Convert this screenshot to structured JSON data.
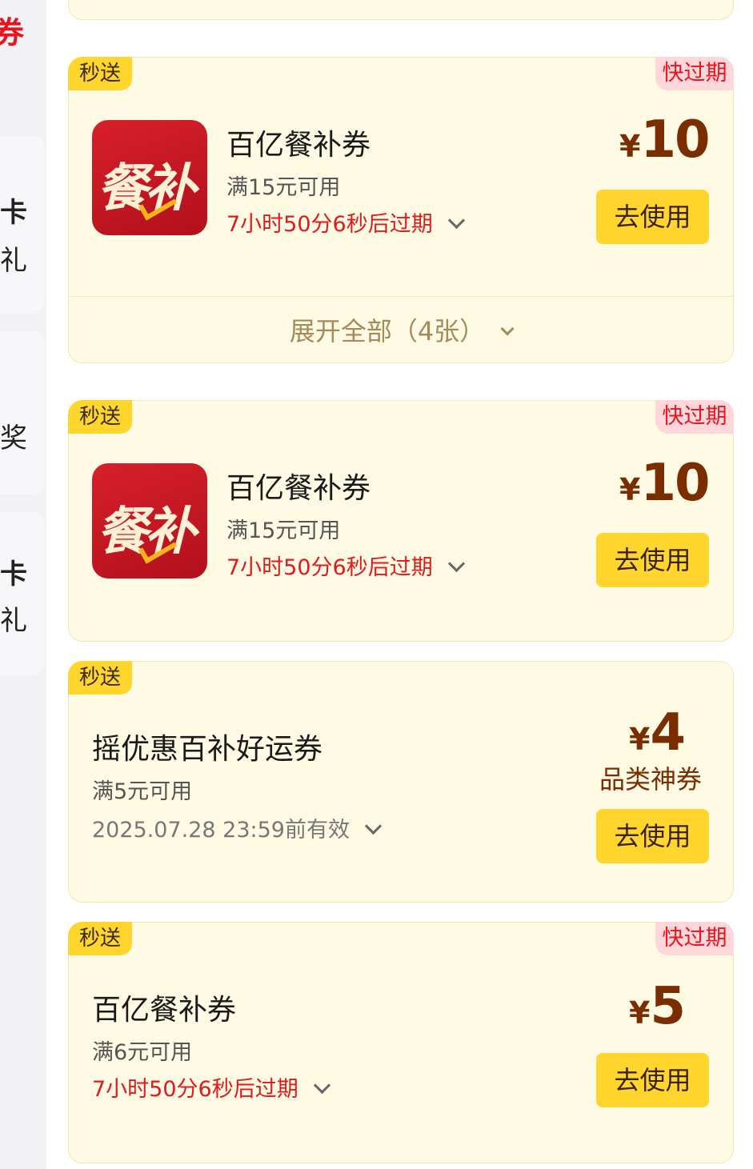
{
  "sidebar": {
    "title_fragment": "券",
    "items": [
      {
        "line1": "卡",
        "line2": "礼"
      },
      {
        "line1": "",
        "line2": "奖"
      },
      {
        "line1": "卡",
        "line2": "礼"
      }
    ]
  },
  "coupons": [
    {
      "badge": "秒送",
      "tag": "快过期",
      "logo_text": "餐补",
      "title": "百亿餐补券",
      "condition": "满15元可用",
      "expiry": "7小时50分6秒后过期",
      "currency": "¥",
      "amount": "10",
      "button": "去使用",
      "expand_label": "展开全部（4张）"
    },
    {
      "badge": "秒送",
      "tag": "快过期",
      "logo_text": "餐补",
      "title": "百亿餐补券",
      "condition": "满15元可用",
      "expiry": "7小时50分6秒后过期",
      "currency": "¥",
      "amount": "10",
      "button": "去使用"
    },
    {
      "badge": "秒送",
      "title": "摇优惠百补好运券",
      "condition": "满5元可用",
      "expiry": "2025.07.28 23:59前有效",
      "currency": "¥",
      "amount": "4",
      "subtitle": "品类神券",
      "button": "去使用"
    },
    {
      "badge": "秒送",
      "tag": "快过期",
      "title": "百亿餐补券",
      "condition": "满6元可用",
      "expiry": "7小时50分6秒后过期",
      "currency": "¥",
      "amount": "5",
      "button": "去使用"
    }
  ],
  "colors": {
    "card_bg": "#fffae3",
    "badge_yellow": "#ffd52e",
    "expiry_red": "#e01a1a",
    "price_brown": "#7a2e00"
  }
}
